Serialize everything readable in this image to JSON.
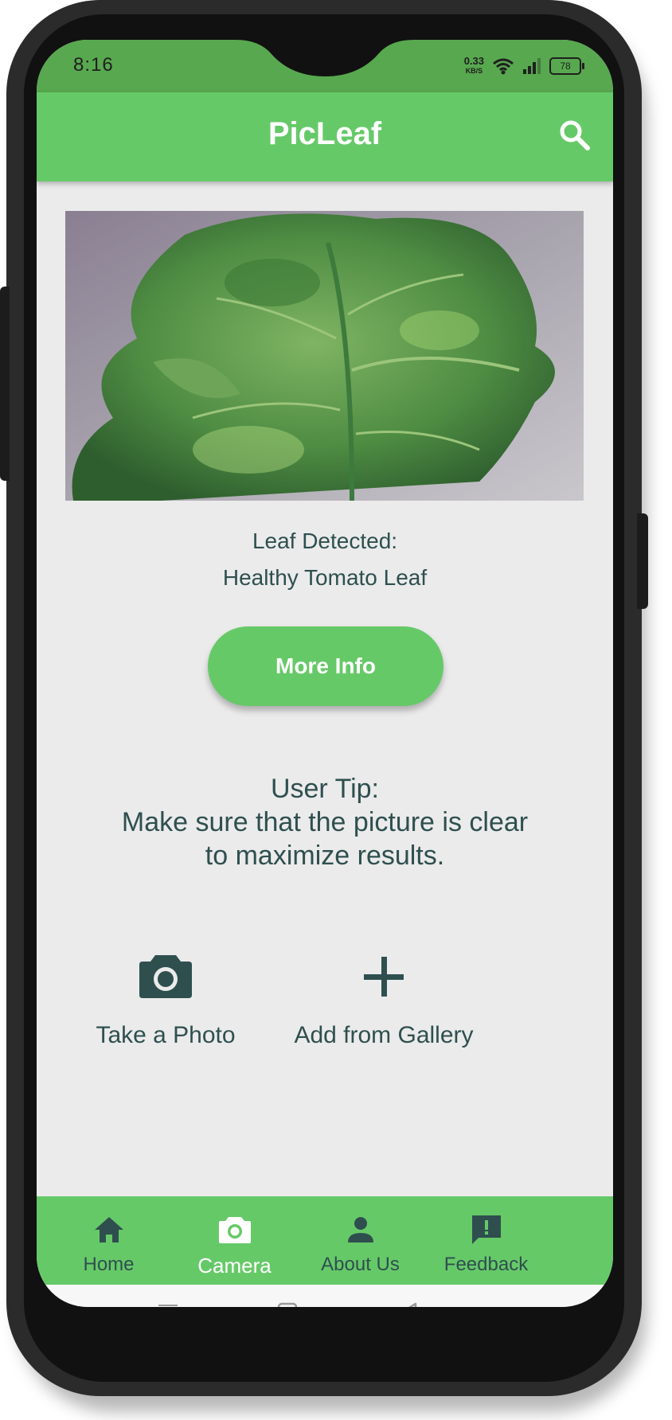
{
  "status_bar": {
    "time": "8:16",
    "net_speed_value": "0.33",
    "net_speed_unit": "KB/S",
    "battery": "78"
  },
  "app_bar": {
    "title": "PicLeaf",
    "search_icon": "search-icon"
  },
  "result": {
    "label": "Leaf Detected:",
    "value": "Healthy Tomato Leaf",
    "button": "More Info"
  },
  "tip": {
    "line1": "User Tip:",
    "line2": "Make sure that the picture is clear",
    "line3": "to maximize results."
  },
  "actions": [
    {
      "label": "Take a Photo",
      "icon": "camera-icon"
    },
    {
      "label": "Add from Gallery",
      "icon": "plus-icon"
    }
  ],
  "bottom_nav": [
    {
      "label": "Home",
      "icon": "home-icon",
      "active": false
    },
    {
      "label": "Camera",
      "icon": "camera-icon",
      "active": true
    },
    {
      "label": "About Us",
      "icon": "person-icon",
      "active": false
    },
    {
      "label": "Feedback",
      "icon": "feedback-icon",
      "active": false
    }
  ],
  "colors": {
    "accent_green": "#66c968",
    "status_green": "#58a84f",
    "text_dark": "#2f4f4f",
    "background": "#ebebeb"
  }
}
